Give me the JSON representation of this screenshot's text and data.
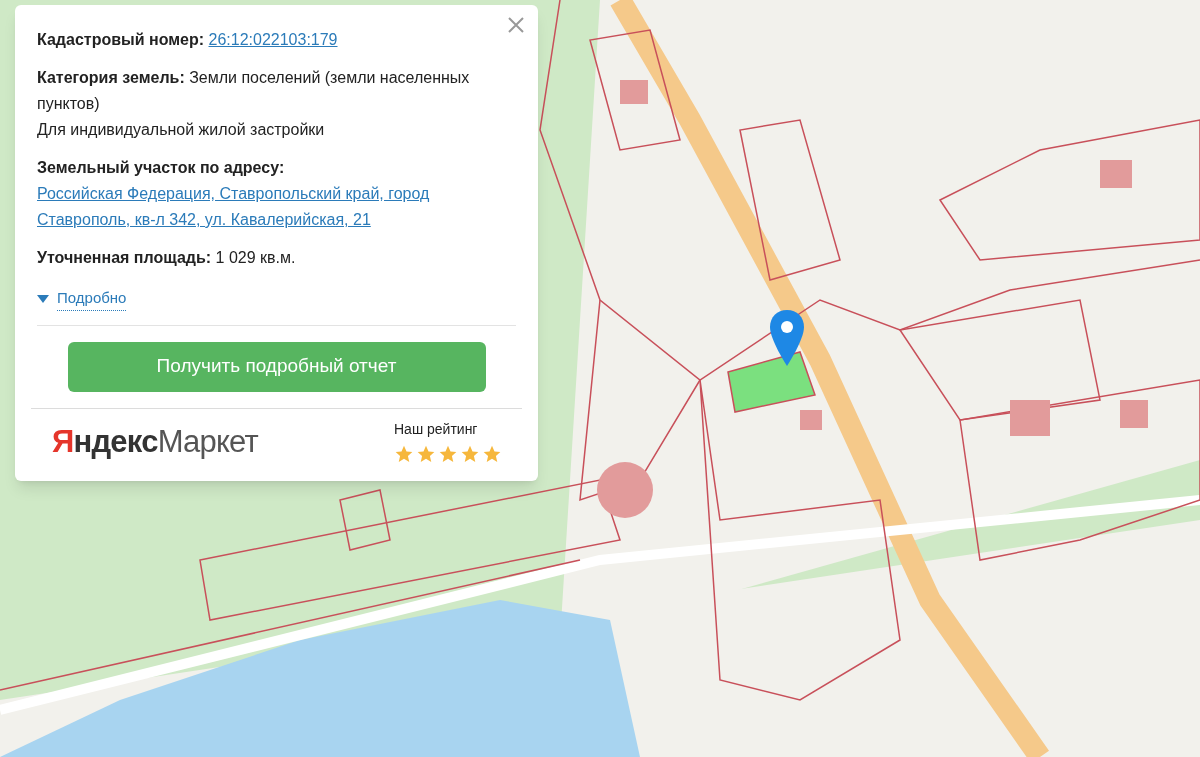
{
  "popup": {
    "fields": [
      {
        "label": "Кадастровый номер:",
        "value": "26:12:022103:179",
        "kind": "link"
      },
      {
        "label": "Категория земель:",
        "value": "Земли поселений (земли населенных пунктов)",
        "note": "Для индивидуальной жилой застройки",
        "kind": "text"
      },
      {
        "label": "Земельный участок по адресу:",
        "value": "Российская Федерация, Ставропольский край, город Ставрополь, кв-л 342, ул. Кавалерийская, 21",
        "kind": "link"
      },
      {
        "label": "Уточненная площадь:",
        "value": "1 029 кв.м.",
        "kind": "text"
      }
    ],
    "details": {
      "label": "Подробно",
      "expanded": false
    },
    "button": "Получить подробный отчет",
    "footer": {
      "logo_brand": "Яндекс",
      "logo_product": "Маркет",
      "rating_label": "Наш рейтинг",
      "stars": 5
    }
  }
}
